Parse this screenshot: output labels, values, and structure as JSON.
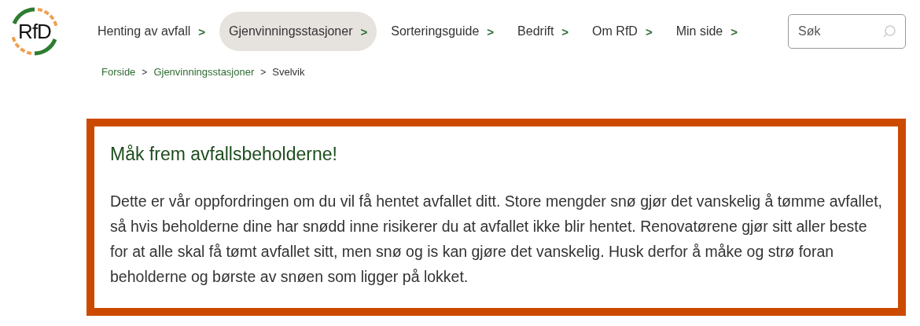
{
  "logo": {
    "text": "RfD"
  },
  "nav": [
    {
      "label": "Henting av avfall",
      "chevron": ">",
      "selected": false
    },
    {
      "label": "Gjenvinningsstasjoner",
      "chevron": ">",
      "selected": true
    },
    {
      "label": "Sorteringsguide",
      "chevron": ">",
      "selected": false
    },
    {
      "label": "Bedrift",
      "chevron": ">",
      "selected": false
    },
    {
      "label": "Om RfD",
      "chevron": ">",
      "selected": false
    },
    {
      "label": "Min side",
      "chevron": ">",
      "selected": false
    }
  ],
  "search": {
    "placeholder": "Søk"
  },
  "breadcrumb": [
    {
      "label": "Forside",
      "link": true
    },
    {
      "label": "Gjenvinningsstasjoner",
      "link": true
    },
    {
      "label": "Svelvik",
      "link": false
    }
  ],
  "breadcrumb_separator": ">",
  "alert": {
    "title": "Måk frem avfallsbeholderne!",
    "body": "Dette er vår oppfordringen om du vil få hentet avfallet ditt. Store mengder snø gjør det vanskelig å tømme avfallet, så hvis beholderne dine har snødd inne risikerer du at avfallet ikke blir hentet. Renovatørene gjør sitt aller beste for at alle skal få tømt avfallet sitt, men snø og is kan gjøre det vanskelig. Husk derfor å måke og strø foran beholderne og børste av snøen som ligger på lokket."
  }
}
